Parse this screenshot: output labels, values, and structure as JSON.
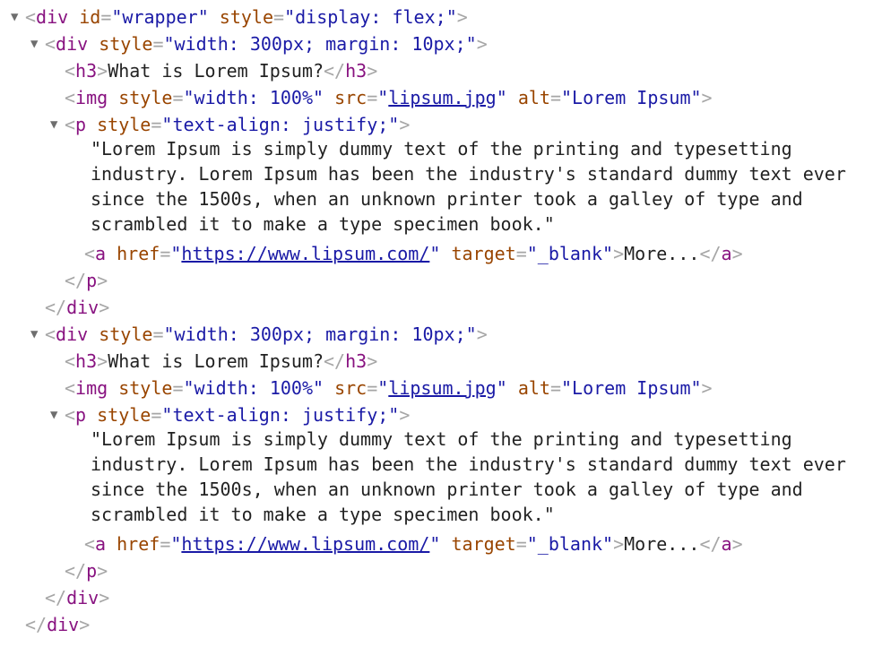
{
  "wrapper_open": {
    "tag": "div",
    "attrs": [
      {
        "name": "id",
        "value": "wrapper"
      },
      {
        "name": "style",
        "value": "display: flex;"
      }
    ]
  },
  "columns": [
    {
      "div_style_name": "style",
      "div_style_value": "width: 300px; margin: 10px;",
      "h3_text": "What is Lorem Ipsum?",
      "img_style_name": "style",
      "img_style_value": "width: 100%",
      "img_src_name": "src",
      "img_src_value": "lipsum.jpg",
      "img_alt_name": "alt",
      "img_alt_value": "Lorem Ipsum",
      "p_style_name": "style",
      "p_style_value": "text-align: justify;",
      "text_lines": [
        "\"Lorem Ipsum is simply dummy text of the printing and typesetting",
        "industry. Lorem Ipsum has been the industry's standard dummy text ever",
        "since the 1500s, when an unknown printer took a galley of type and",
        "scrambled it to make a type specimen book.\""
      ],
      "a_href_name": "href",
      "a_href_value": "https://www.lipsum.com/",
      "a_target_name": "target",
      "a_target_value": "_blank",
      "a_text": "More..."
    },
    {
      "div_style_name": "style",
      "div_style_value": "width: 300px; margin: 10px;",
      "h3_text": "What is Lorem Ipsum?",
      "img_style_name": "style",
      "img_style_value": "width: 100%",
      "img_src_name": "src",
      "img_src_value": "lipsum.jpg",
      "img_alt_name": "alt",
      "img_alt_value": "Lorem Ipsum",
      "p_style_name": "style",
      "p_style_value": "text-align: justify;",
      "text_lines": [
        "\"Lorem Ipsum is simply dummy text of the printing and typesetting",
        "industry. Lorem Ipsum has been the industry's standard dummy text ever",
        "since the 1500s, when an unknown printer took a galley of type and",
        "scrambled it to make a type specimen book.\""
      ],
      "a_href_name": "href",
      "a_href_value": "https://www.lipsum.com/",
      "a_target_name": "target",
      "a_target_value": "_blank",
      "a_text": "More..."
    }
  ],
  "tags": {
    "div": "div",
    "h3": "h3",
    "img": "img",
    "p": "p",
    "a": "a"
  },
  "icons": {
    "expanded": "triangle-down"
  }
}
